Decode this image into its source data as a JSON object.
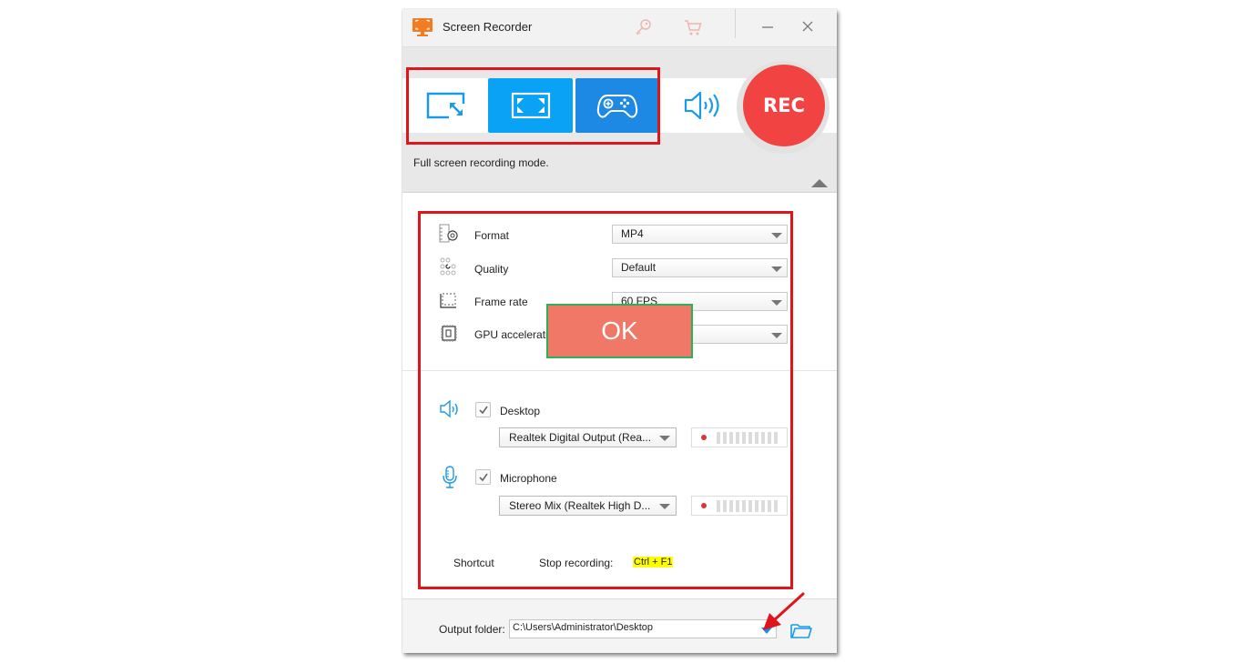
{
  "window": {
    "title": "Screen Recorder",
    "icons": {
      "app": "monitor-record-icon",
      "key": "key-icon",
      "cart": "cart-icon",
      "minimize": "minimize-icon",
      "close": "close-icon"
    }
  },
  "modes": {
    "items": [
      {
        "name": "region",
        "icon": "region-select-icon",
        "selected": false
      },
      {
        "name": "fullscreen",
        "icon": "fullscreen-icon",
        "selected": true
      },
      {
        "name": "game",
        "icon": "gamepad-icon",
        "selected": false
      },
      {
        "name": "audio-only",
        "icon": "speaker-icon",
        "selected": false
      }
    ],
    "rec_label": "REC",
    "description": "Full screen recording mode.",
    "colors": {
      "selected": "#0aa2f4",
      "game": "#1e88e5",
      "rec": "#f24343",
      "highlight": "#e0141b"
    }
  },
  "settings": {
    "format": {
      "label": "Format",
      "value": "MP4"
    },
    "quality": {
      "label": "Quality",
      "value": "Default"
    },
    "frame_rate": {
      "label": "Frame rate",
      "value": "60 FPS"
    },
    "gpu": {
      "label": "GPU acceleration",
      "value": ""
    }
  },
  "overlay": {
    "ok_label": "OK",
    "bg": "#f07866",
    "border": "#2cb05a"
  },
  "audio": {
    "desktop": {
      "label": "Desktop",
      "checked": true,
      "device": "Realtek Digital Output (Rea...",
      "level": 0
    },
    "microphone": {
      "label": "Microphone",
      "checked": true,
      "device": "Stereo Mix (Realtek High D...",
      "level": 0
    }
  },
  "shortcut": {
    "label": "Shortcut",
    "stop_label": "Stop recording:",
    "stop_key": "Ctrl + F1"
  },
  "output": {
    "label": "Output folder:",
    "path": "C:\\Users\\Administrator\\Desktop"
  }
}
